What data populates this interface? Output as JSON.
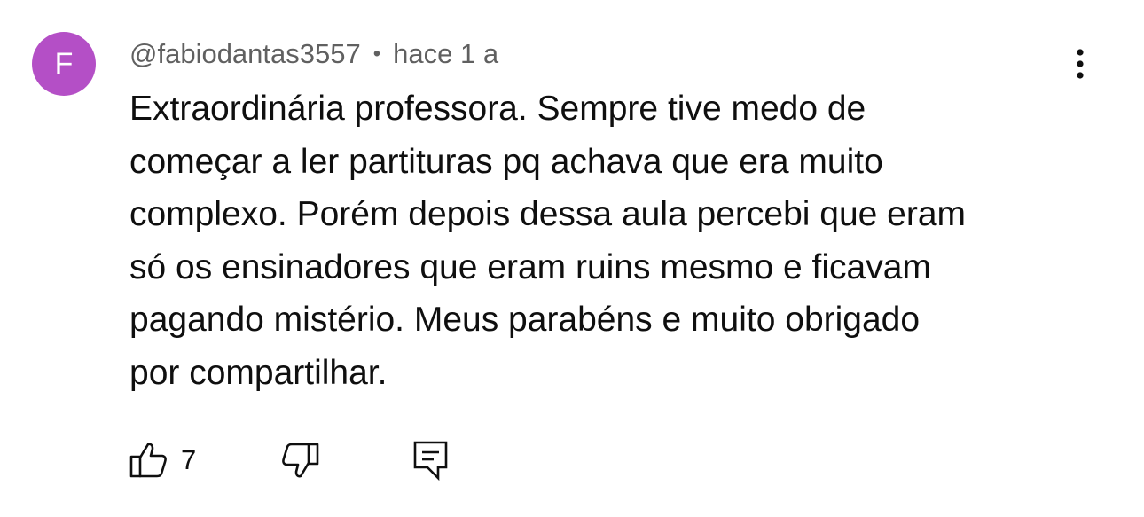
{
  "comment": {
    "avatar_letter": "F",
    "avatar_color": "#b44fc6",
    "author": "@fabiodantas3557",
    "separator": "•",
    "time": "hace 1 a",
    "text": "Extraordinária professora. Sempre tive medo de\ncomeçar a ler partituras pq achava que era muito\ncomplexo. Porém depois dessa aula percebi que eram\nsó os ensinadores que eram ruins mesmo e ficavam\npagando mistério. Meus parabéns e muito obrigado\npor compartilhar.",
    "like_count": "7"
  },
  "icons": {
    "more": "more-vertical-icon",
    "like": "thumbs-up-icon",
    "dislike": "thumbs-down-icon",
    "reply": "reply-comment-icon"
  }
}
